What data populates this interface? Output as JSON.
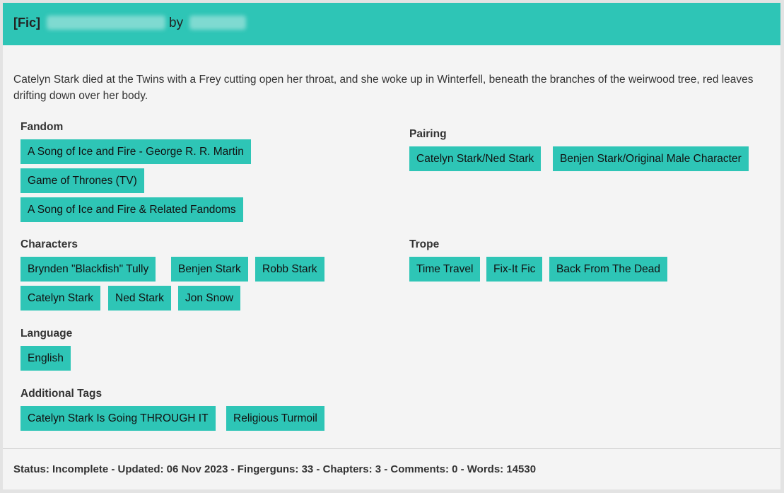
{
  "header": {
    "prefix": "[Fic]",
    "by_label": "by"
  },
  "summary": "Catelyn Stark died at the Twins with a Frey cutting open her throat, and she woke up in Winterfell, beneath the branches of the weirwood tree, red leaves drifting down over her body.",
  "sections": {
    "fandom": {
      "label": "Fandom",
      "tags": [
        "A Song of Ice and Fire - George R. R. Martin",
        "Game of Thrones (TV)",
        "A Song of Ice and Fire & Related Fandoms"
      ]
    },
    "pairing": {
      "label": "Pairing",
      "tags": [
        "Catelyn Stark/Ned Stark",
        "Benjen Stark/Original Male Character"
      ]
    },
    "characters": {
      "label": "Characters",
      "tags": [
        "Brynden \"Blackfish\" Tully",
        "Benjen Stark",
        "Robb Stark",
        "Catelyn Stark",
        "Ned Stark",
        "Jon Snow"
      ]
    },
    "trope": {
      "label": "Trope",
      "tags": [
        "Time Travel",
        "Fix-It Fic",
        "Back From The Dead"
      ]
    },
    "language": {
      "label": "Language",
      "tags": [
        "English"
      ]
    },
    "additional": {
      "label": "Additional Tags",
      "tags": [
        "Catelyn Stark Is Going THROUGH IT",
        "Religious Turmoil"
      ]
    }
  },
  "footer": {
    "status": "Status: Incomplete - Updated: 06 Nov 2023 - Fingerguns: 33 - Chapters: 3 - Comments: 0 - Words: 14530"
  },
  "colors": {
    "accent": "#2ec5b6",
    "background": "#f4f4f4"
  }
}
